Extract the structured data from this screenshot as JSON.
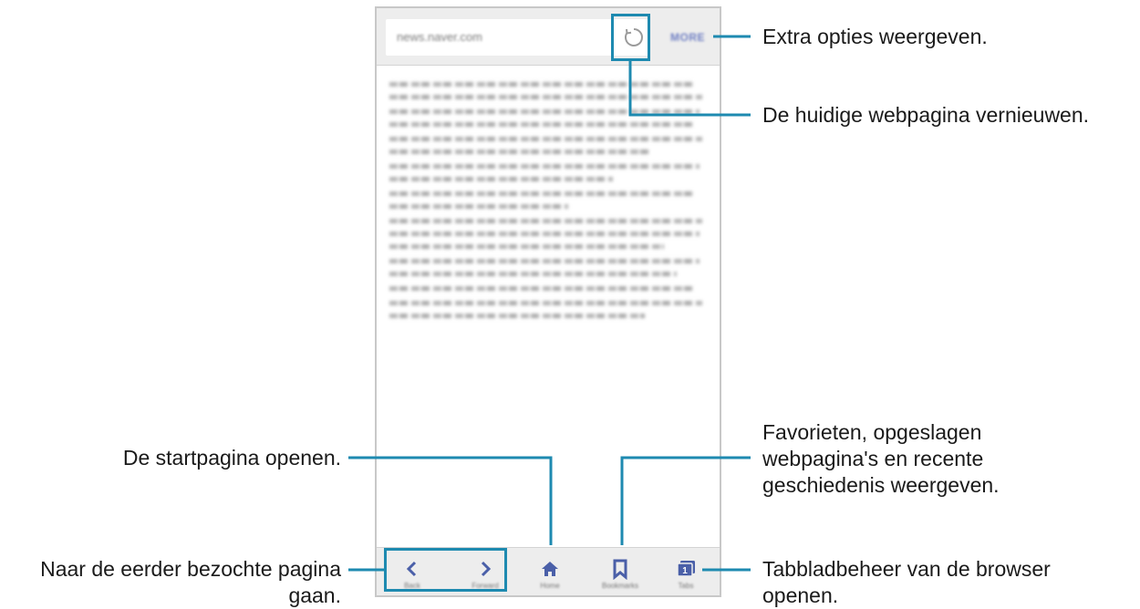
{
  "browser": {
    "url": "news.naver.com",
    "more_label": "MORE",
    "nav": {
      "back_sub": "Back",
      "forward_sub": "Forward",
      "home_sub": "Home",
      "bookmarks_sub": "Bookmarks",
      "tabs_sub": "Tabs",
      "tab_count": "1"
    }
  },
  "callouts": {
    "more": "Extra opties weergeven.",
    "refresh": "De huidige webpagina vernieuwen.",
    "home": "De startpagina openen.",
    "bookmarks_1": "Favorieten, opgeslagen",
    "bookmarks_2": "webpagina's en recente",
    "bookmarks_3": "geschiedenis weergeven.",
    "back_forward_1": "Naar de eerder bezochte pagina",
    "back_forward_2": "gaan.",
    "tabs_1": "Tabbladbeheer van de browser",
    "tabs_2": "openen."
  },
  "colors": {
    "callout_line": "#1e8ab0",
    "icon_blue": "#4a5fa8",
    "more_text": "#6f7fc3"
  }
}
